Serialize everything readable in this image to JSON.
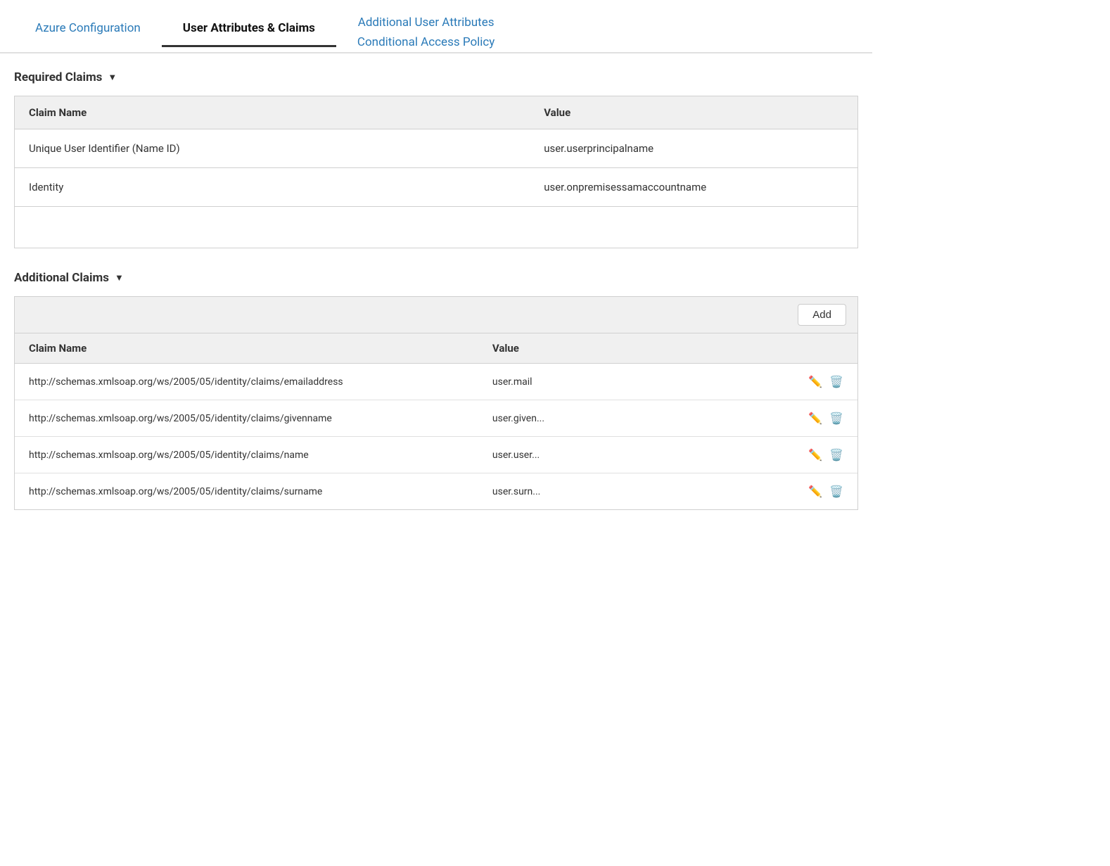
{
  "nav": {
    "tabs": [
      {
        "id": "azure-config",
        "label": "Azure Configuration",
        "active": false
      },
      {
        "id": "user-attributes",
        "label": "User Attributes & Claims",
        "active": true
      },
      {
        "id": "additional-user-attributes",
        "label": "Additional User Attributes",
        "active": false
      },
      {
        "id": "conditional-access",
        "label": "Conditional Access Policy",
        "active": false
      }
    ]
  },
  "required_claims": {
    "section_label": "Required Claims",
    "chevron": "▼",
    "col_name": "Claim Name",
    "col_value": "Value",
    "rows": [
      {
        "name": "Unique User Identifier (Name ID)",
        "value": "user.userprincipalname"
      },
      {
        "name": "Identity",
        "value": "user.onpremisessamaccountname"
      }
    ]
  },
  "additional_claims": {
    "section_label": "Additional Claims",
    "chevron": "▼",
    "add_button_label": "Add",
    "col_name": "Claim Name",
    "col_value": "Value",
    "rows": [
      {
        "name": "http://schemas.xmlsoap.org/ws/2005/05/identity/claims/emailaddress",
        "value": "user.mail"
      },
      {
        "name": "http://schemas.xmlsoap.org/ws/2005/05/identity/claims/givenname",
        "value": "user.given..."
      },
      {
        "name": "http://schemas.xmlsoap.org/ws/2005/05/identity/claims/name",
        "value": "user.user..."
      },
      {
        "name": "http://schemas.xmlsoap.org/ws/2005/05/identity/claims/surname",
        "value": "user.surn..."
      }
    ]
  }
}
